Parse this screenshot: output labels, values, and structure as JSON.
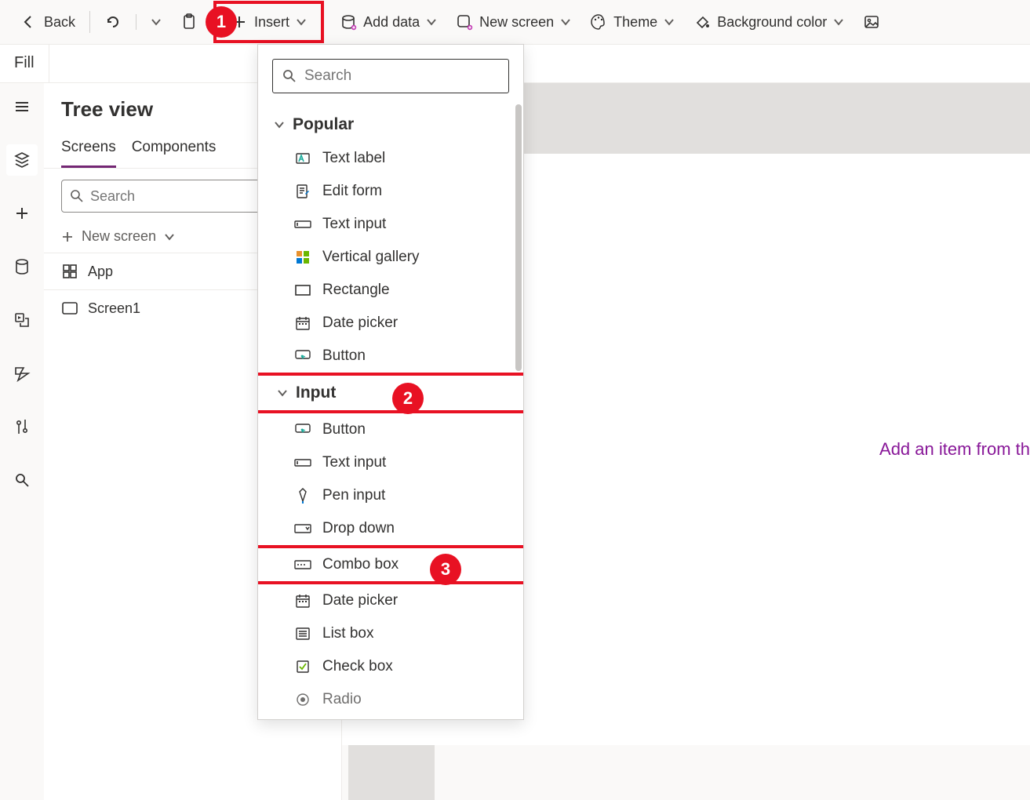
{
  "toolbar": {
    "back": "Back",
    "insert": "Insert",
    "add_data": "Add data",
    "new_screen": "New screen",
    "theme": "Theme",
    "background_color": "Background color"
  },
  "formula": {
    "property": "Fill"
  },
  "panel": {
    "title": "Tree view",
    "tab_screens": "Screens",
    "tab_components": "Components",
    "search_placeholder": "Search",
    "new_screen": "New screen",
    "items": {
      "app": "App",
      "screen1": "Screen1"
    }
  },
  "insert_panel": {
    "search_placeholder": "Search",
    "groups": {
      "popular": "Popular",
      "input": "Input"
    },
    "popular_items": [
      "Text label",
      "Edit form",
      "Text input",
      "Vertical gallery",
      "Rectangle",
      "Date picker",
      "Button"
    ],
    "input_items": [
      "Button",
      "Text input",
      "Pen input",
      "Drop down",
      "Combo box",
      "Date picker",
      "List box",
      "Check box",
      "Radio"
    ]
  },
  "canvas": {
    "message": "Add an item from th"
  },
  "badges": {
    "b1": "1",
    "b2": "2",
    "b3": "3"
  }
}
